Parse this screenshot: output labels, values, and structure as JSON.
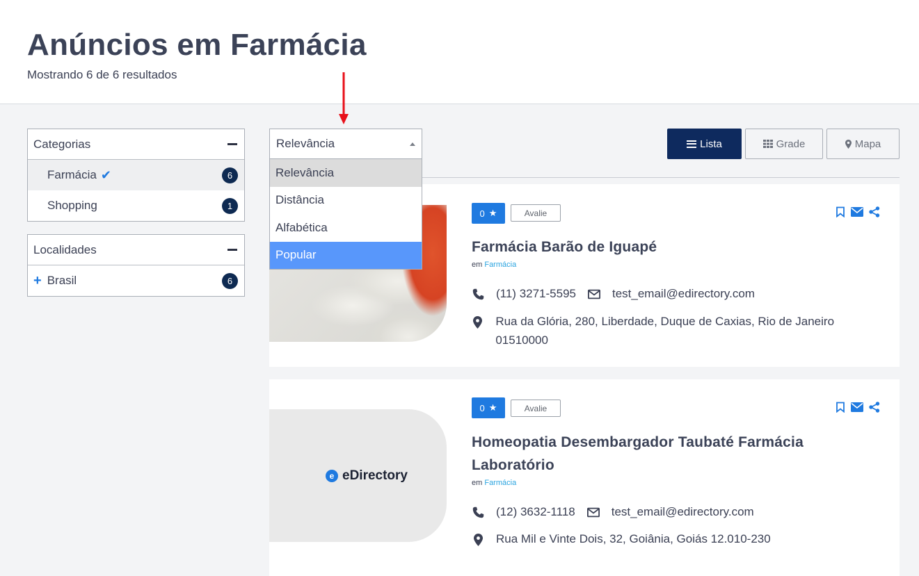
{
  "header": {
    "title": "Anúncios em Farmácia",
    "results": "Mostrando 6 de 6 resultados"
  },
  "sidebar": {
    "categories": {
      "title": "Categorias",
      "items": [
        {
          "label": "Farmácia",
          "count": "6",
          "active": true
        },
        {
          "label": "Shopping",
          "count": "1",
          "active": false
        }
      ]
    },
    "locations": {
      "title": "Localidades",
      "items": [
        {
          "label": "Brasil",
          "count": "6"
        }
      ]
    }
  },
  "sort": {
    "selected": "Relevância",
    "options": [
      "Relevância",
      "Distância",
      "Alfabética",
      "Popular"
    ],
    "highlighted": "Popular"
  },
  "view": {
    "lista": "Lista",
    "grade": "Grade",
    "mapa": "Mapa"
  },
  "listings": [
    {
      "rating": "0",
      "rate_label": "Avalie",
      "title": "Farmácia Barão de Iguapé",
      "category_prefix": "em",
      "category": "Farmácia",
      "phone": "(11) 3271-5595",
      "email": "test_email@edirectory.com",
      "address": "Rua da Glória, 280, Liberdade, Duque de Caxias, Rio de Janeiro 01510000"
    },
    {
      "rating": "0",
      "rate_label": "Avalie",
      "title": "Homeopatia Desembargador Taubaté Farmácia Laboratório",
      "category_prefix": "em",
      "category": "Farmácia",
      "phone": "(12) 3632-1118",
      "email": "test_email@edirectory.com",
      "address": "Rua Mil e Vinte Dois, 32, Goiânia, Goiás 12.010-230",
      "logo_text": "eDirectory",
      "logo_mark": "e"
    }
  ],
  "colors": {
    "accent": "#1f7ae0",
    "navy": "#0e2a5e",
    "dropdown_selected": "#5897fb",
    "arrow": "#e8101a"
  }
}
